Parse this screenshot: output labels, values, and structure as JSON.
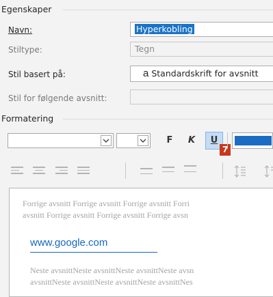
{
  "properties": {
    "title": "Egenskaper",
    "name_label": "Navn:",
    "name_value": "Hyperkobling",
    "style_type_label": "Stiltype:",
    "style_type_value": "Tegn",
    "based_on_label": "Stil basert på:",
    "based_on_icon": "a",
    "based_on_value": "Standardskrift for avsnitt",
    "following_label": "Stil for følgende avsnitt:",
    "following_value": ""
  },
  "formatting": {
    "title": "Formatering",
    "font_value": "",
    "size_value": "",
    "bold_label": "F",
    "italic_label": "K",
    "underline_label": "U",
    "callout_number": "7",
    "font_color": "#1c6cc4"
  },
  "preview": {
    "prev_line1": "Forrige avsnitt Forrige avsnitt Forrige avsnitt Forri",
    "prev_line2": "avsnitt Forrige avsnitt Forrige avsnitt Forrige avsn",
    "sample": "www.google.com",
    "next_line1": "Neste avsnittNeste avsnittNeste avsnittNeste avsn",
    "next_line2": "avsnittNeste avsnittNeste avsnittNeste avsnittNes"
  },
  "colors": {
    "accent": "#1a73c8",
    "callout": "#c8361b",
    "link": "#1467c2"
  }
}
